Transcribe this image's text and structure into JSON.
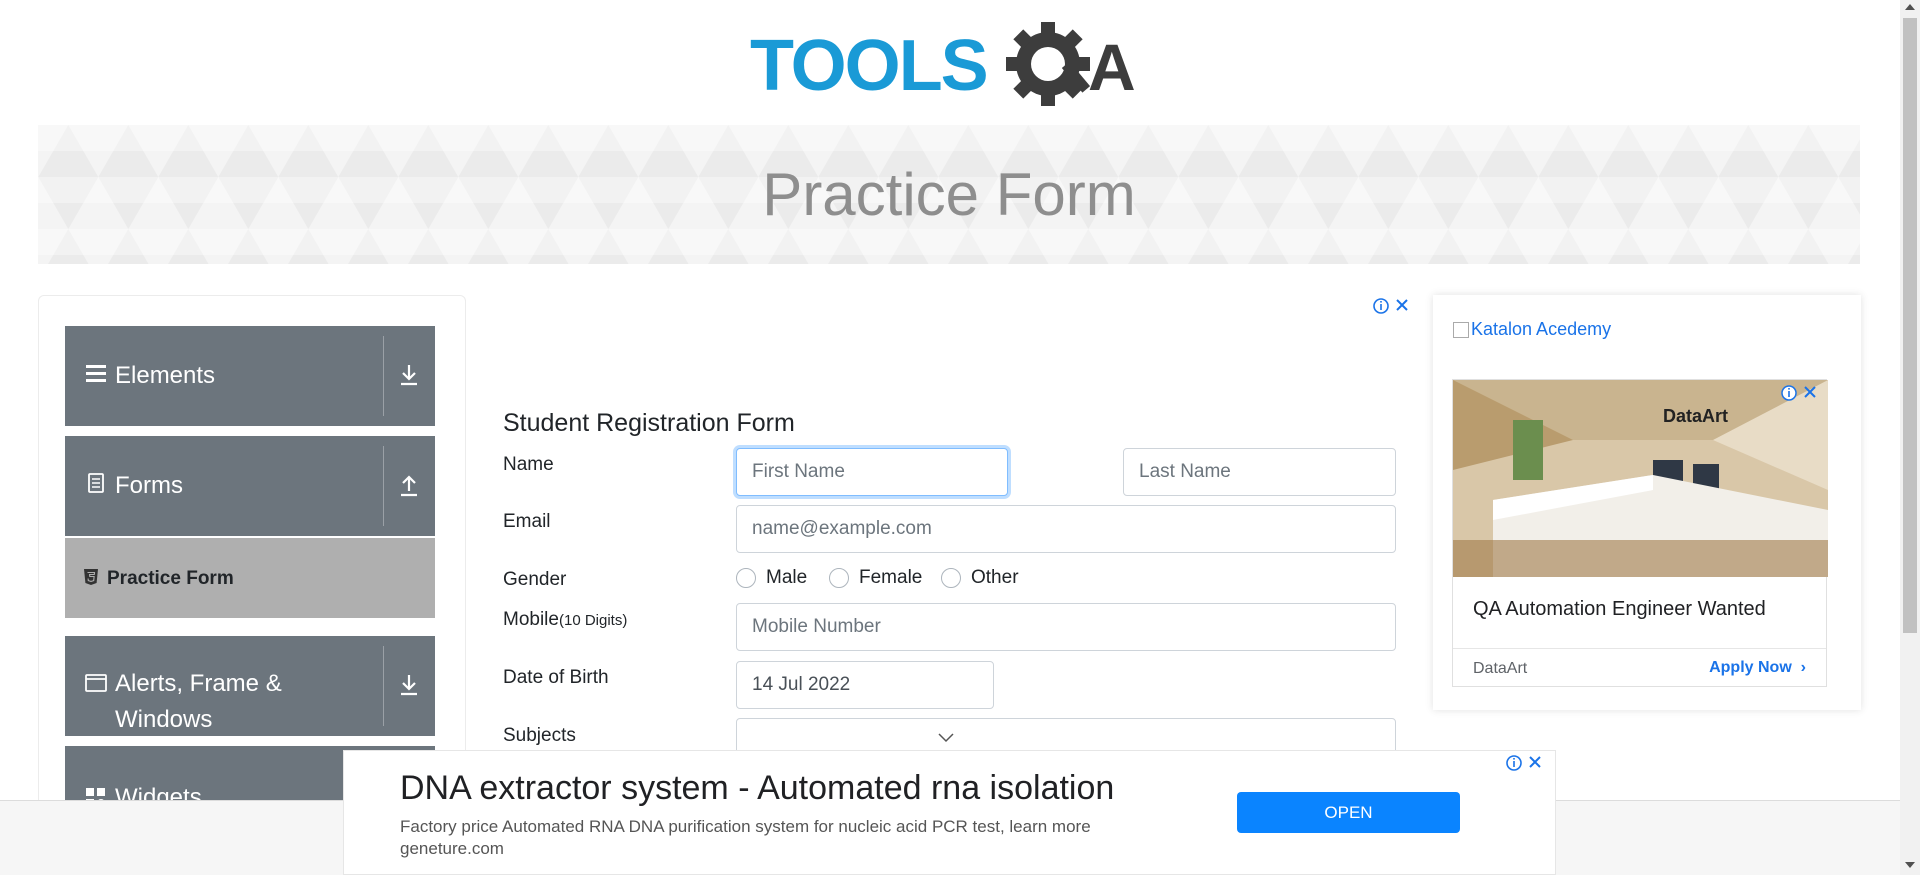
{
  "header": {
    "logo_text": "TOOLSQA",
    "banner_title": "Practice Form"
  },
  "sidebar": {
    "groups": [
      {
        "label": "Elements",
        "icon": "hamburger-icon",
        "expand_icon": "download-arrow-icon"
      },
      {
        "label": "Forms",
        "icon": "document-icon",
        "expand_icon": "upload-arrow-icon"
      },
      {
        "label": "Alerts, Frame & Windows",
        "icon": "window-icon",
        "expand_icon": "download-arrow-icon"
      },
      {
        "label": "Widgets",
        "icon": "widgets-icon"
      }
    ],
    "active_item": {
      "label": "Practice Form",
      "icon": "html5-icon"
    }
  },
  "form": {
    "title": "Student Registration Form",
    "name_label": "Name",
    "first_name_placeholder": "First Name",
    "last_name_placeholder": "Last Name",
    "email_label": "Email",
    "email_placeholder": "name@example.com",
    "gender_label": "Gender",
    "gender_options": [
      "Male",
      "Female",
      "Other"
    ],
    "mobile_label": "Mobile",
    "mobile_hint": "(10 Digits)",
    "mobile_placeholder": "Mobile Number",
    "dob_label": "Date of Birth",
    "dob_value": "14 Jul 2022",
    "subjects_label": "Subjects"
  },
  "right_ad": {
    "image_alt": "Katalon Acedemy",
    "photo_brand": "DataArt",
    "headline": "QA Automation Engineer Wanted",
    "advertiser": "DataArt",
    "cta": "Apply Now"
  },
  "bottom_ad": {
    "headline": "DNA extractor system - Automated rna isolation",
    "description": "Factory price Automated RNA DNA purification system for nucleic acid PCR test, learn more",
    "domain": "geneture.com",
    "button": "OPEN"
  },
  "colors": {
    "logo_blue": "#1a9ad6",
    "logo_dark": "#3d3d3d",
    "sidebar_bg": "#6c757d",
    "active_bg": "#afafaf",
    "open_button": "#0a84ff"
  }
}
